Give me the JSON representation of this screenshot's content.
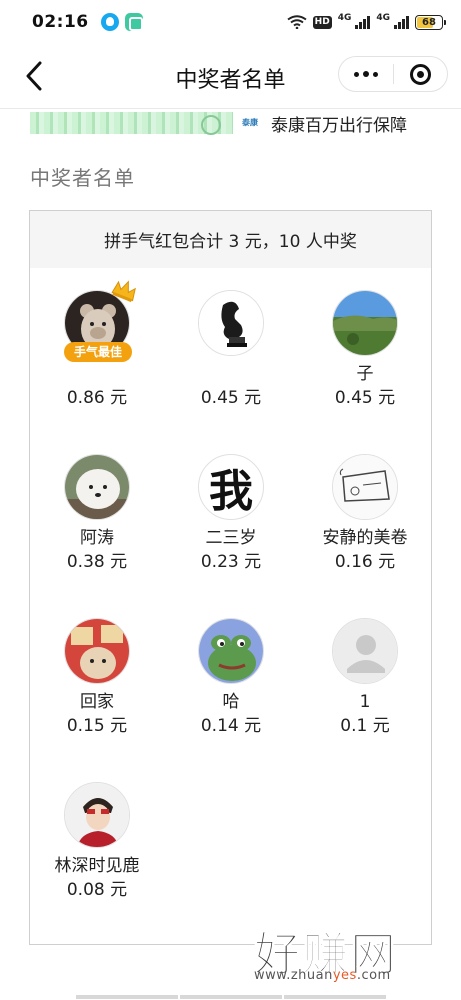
{
  "status_bar": {
    "time": "02:16",
    "hd_label": "HD",
    "net_1": "4G",
    "net_2": "4G",
    "battery": "68"
  },
  "nav": {
    "title": "中奖者名单"
  },
  "banner": {
    "logo_text": "泰康",
    "text": "泰康百万出行保障"
  },
  "section_title": "中奖者名单",
  "card": {
    "summary": "拼手气红包合计 3 元，10 人中奖",
    "best_badge": "手气最佳",
    "winners": [
      {
        "name": "",
        "amount": "0.86 元",
        "avatar": "bear-avatar",
        "best": true
      },
      {
        "name": "",
        "amount": "0.45 元",
        "avatar": "figure-avatar"
      },
      {
        "name": "子",
        "amount": "0.45 元",
        "avatar": "landscape-avatar"
      },
      {
        "name": "阿涛",
        "amount": "0.38 元",
        "avatar": "dog-avatar"
      },
      {
        "name": "二三岁",
        "amount": "0.23 元",
        "avatar": "wo-character-avatar",
        "avatar_text": "我"
      },
      {
        "name": "安静的美卷",
        "amount": "0.16 元",
        "avatar": "sketch-avatar"
      },
      {
        "name": "回家",
        "amount": "0.15 元",
        "avatar": "cartoon-avatar"
      },
      {
        "name": "哈",
        "amount": "0.14 元",
        "avatar": "frog-avatar"
      },
      {
        "name": "1",
        "amount": "0.1 元",
        "avatar": "default-avatar"
      },
      {
        "name": "林深时见鹿",
        "amount": "0.08 元",
        "avatar": "boy-avatar"
      }
    ]
  },
  "watermark": {
    "big": "好赚网",
    "url_prefix": "www.zhuan",
    "url_highlight": "yes",
    "url_suffix": ".com"
  },
  "colors": {
    "badge": "#f3a10e",
    "card_header_bg": "#f5f5f5",
    "watermark_accent": "#e25b2a"
  }
}
